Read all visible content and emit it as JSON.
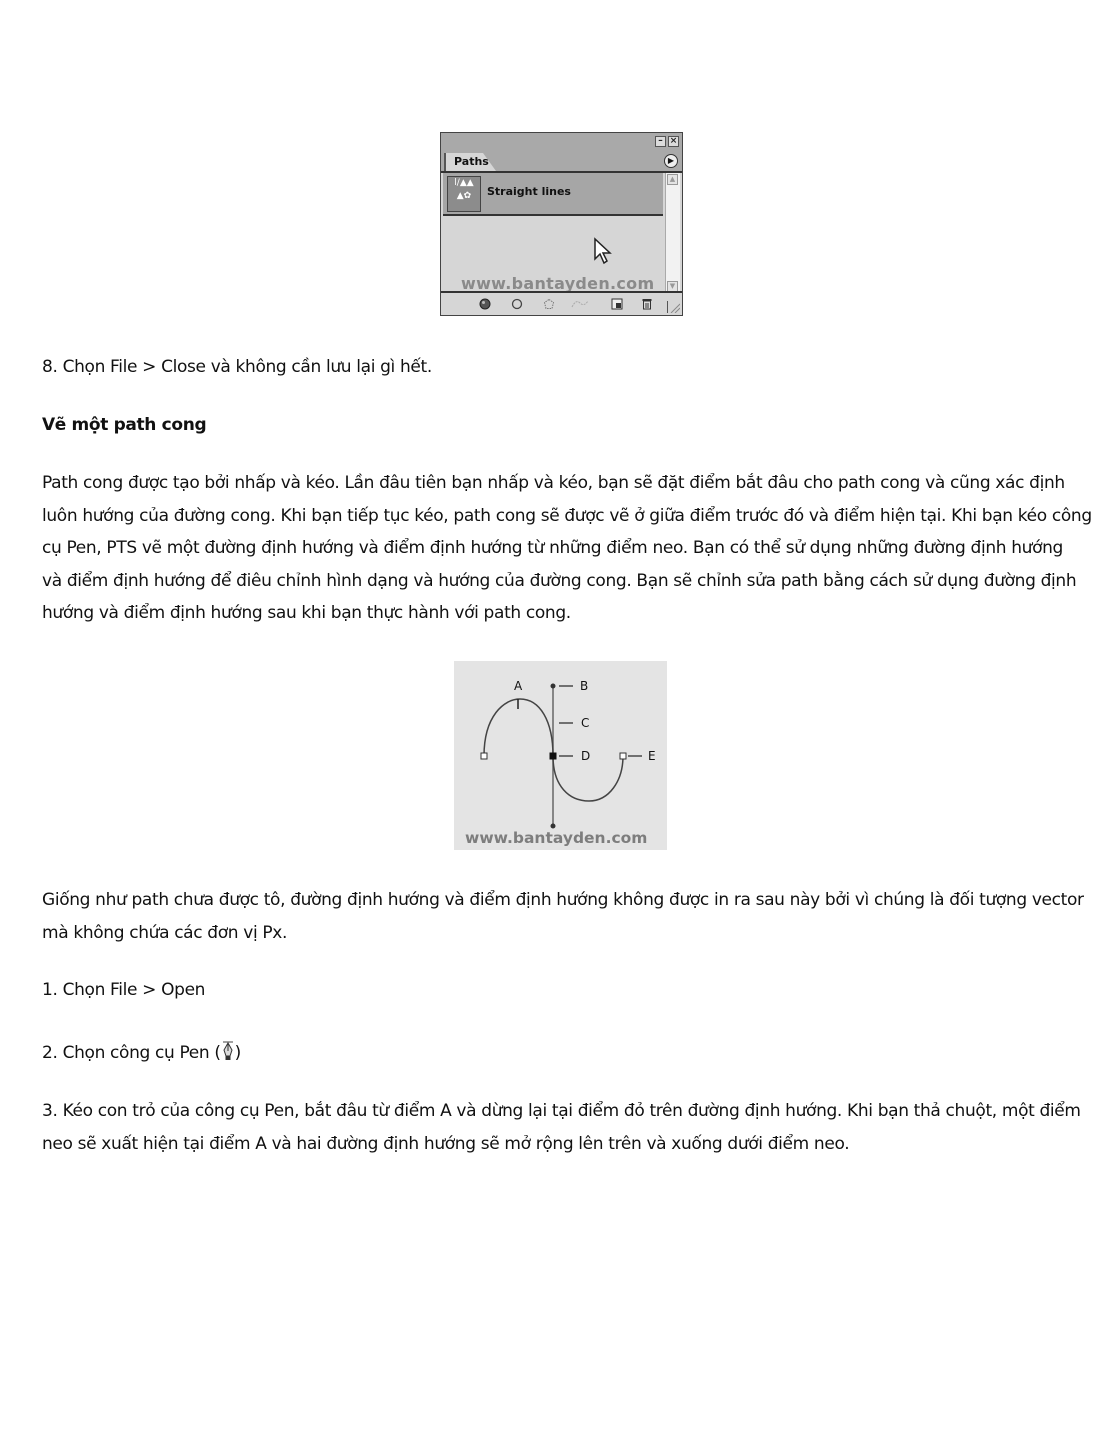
{
  "paths_panel": {
    "tab_label": "Paths",
    "minimize_icon": "minimize-icon",
    "close_icon": "close-icon",
    "menu_icon": "panel-menu-arrow-icon",
    "path_item": {
      "name": "Straight lines",
      "thumbnail_icon": "path-thumbnail-icon"
    },
    "watermark": "www.bantayden.com",
    "toolbar_icons": [
      "fill-path-icon",
      "stroke-path-icon",
      "load-as-selection-icon",
      "make-work-path-icon",
      "new-path-icon",
      "delete-path-icon"
    ]
  },
  "step8": "8. Chọn File > Close và không  cần lưu lại gì hết.",
  "section_heading": "Vẽ một path cong",
  "intro_paragraph_lines": [
    "Path cong được tạo bởi nhấp và kéo. Lần đâu tiên bạn nhấp và kéo, bạn sẽ đặt điểm bắt đâu cho path cong và cũng xác định",
    "luôn hướng của đường cong. Khi bạn tiếp tục kéo, path cong sẽ được vẽ ở giữa điểm trước đó và điểm hiện tại. Khi bạn kéo công",
    "cụ Pen, PTS vẽ một đường định hướng và điểm định hướng từ những điểm neo. Bạn có thể sử dụng những đường định hướng",
    "và điểm định hướng để điêu chỉnh hình dạng và hướng của đường cong. Bạn sẽ chỉnh sửa path bằng cách sử dụng đường định",
    "hướng và điểm định hướng sau khi bạn thực hành với path cong."
  ],
  "curve_diagram": {
    "labels": {
      "a": "A",
      "b": "B",
      "c": "C",
      "d": "D",
      "e": "E"
    },
    "watermark": "www.bantayden.com"
  },
  "note_paragraph_lines": [
    "Giống như path chưa được tô, đường định hướng và điểm định hướng không được in ra sau này bởi vì chúng là đối tượng vector",
    "mà không chứa các đơn vị Px."
  ],
  "step1": "1. Chọn File > Open",
  "step2": {
    "before": "2. Chọn công cụ Pen (",
    "icon": "pen-tool-icon",
    "after": ")"
  },
  "step3_lines": [
    "3. Kéo con trỏ của công cụ Pen, bắt đâu từ điểm A và dừng lại tại điểm đỏ trên đường định hướng. Khi bạn thả chuột, một điểm",
    "neo sẽ xuất hiện tại điểm A và hai đường định hướng sẽ mở rộng lên trên và xuống dưới điểm neo."
  ]
}
